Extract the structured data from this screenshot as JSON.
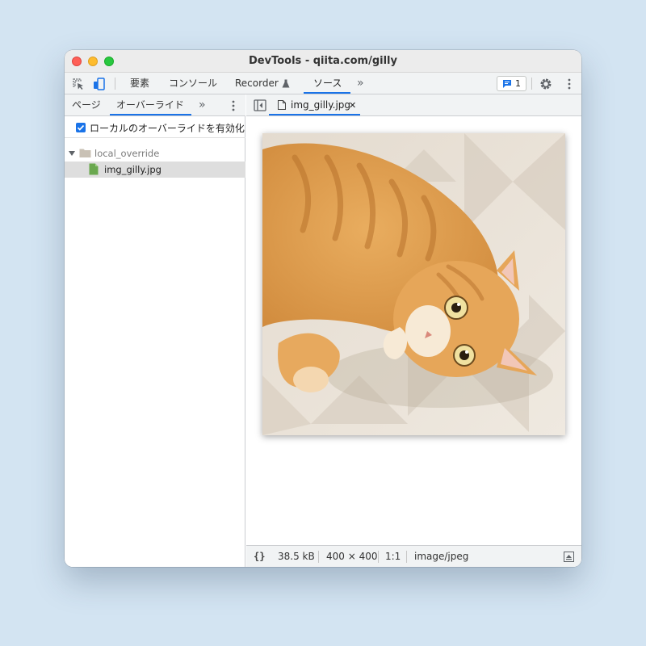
{
  "window": {
    "title": "DevTools - qiita.com/gilly"
  },
  "toolbar": {
    "tabs": [
      {
        "label": "要素"
      },
      {
        "label": "コンソール"
      },
      {
        "label": "Recorder"
      },
      {
        "label": "ソース",
        "active": true
      }
    ],
    "issues_count": "1",
    "more_tabs_glyph": "»"
  },
  "left_panel": {
    "tabs": [
      {
        "label": "ページ"
      },
      {
        "label": "オーバーライド",
        "active": true
      }
    ],
    "more_tabs_glyph": "»",
    "enable_overrides_label": "ローカルのオーバーライドを有効化",
    "enable_overrides_checked": true,
    "tree": {
      "folder": "local_override",
      "file": "img_gilly.jpg"
    }
  },
  "editor": {
    "open_tab": "img_gilly.jpg",
    "close_glyph": "✕"
  },
  "status_bar": {
    "format_glyph": "{}",
    "file_size": "38.5 kB",
    "dimensions": "400 × 400",
    "ratio": "1:1",
    "mime_type": "image/jpeg"
  },
  "colors": {
    "accent": "#1a73e8",
    "toolbar_bg": "#f1f3f4",
    "file_icon": "#6aa84f",
    "folder_icon": "#c9c1b5"
  }
}
